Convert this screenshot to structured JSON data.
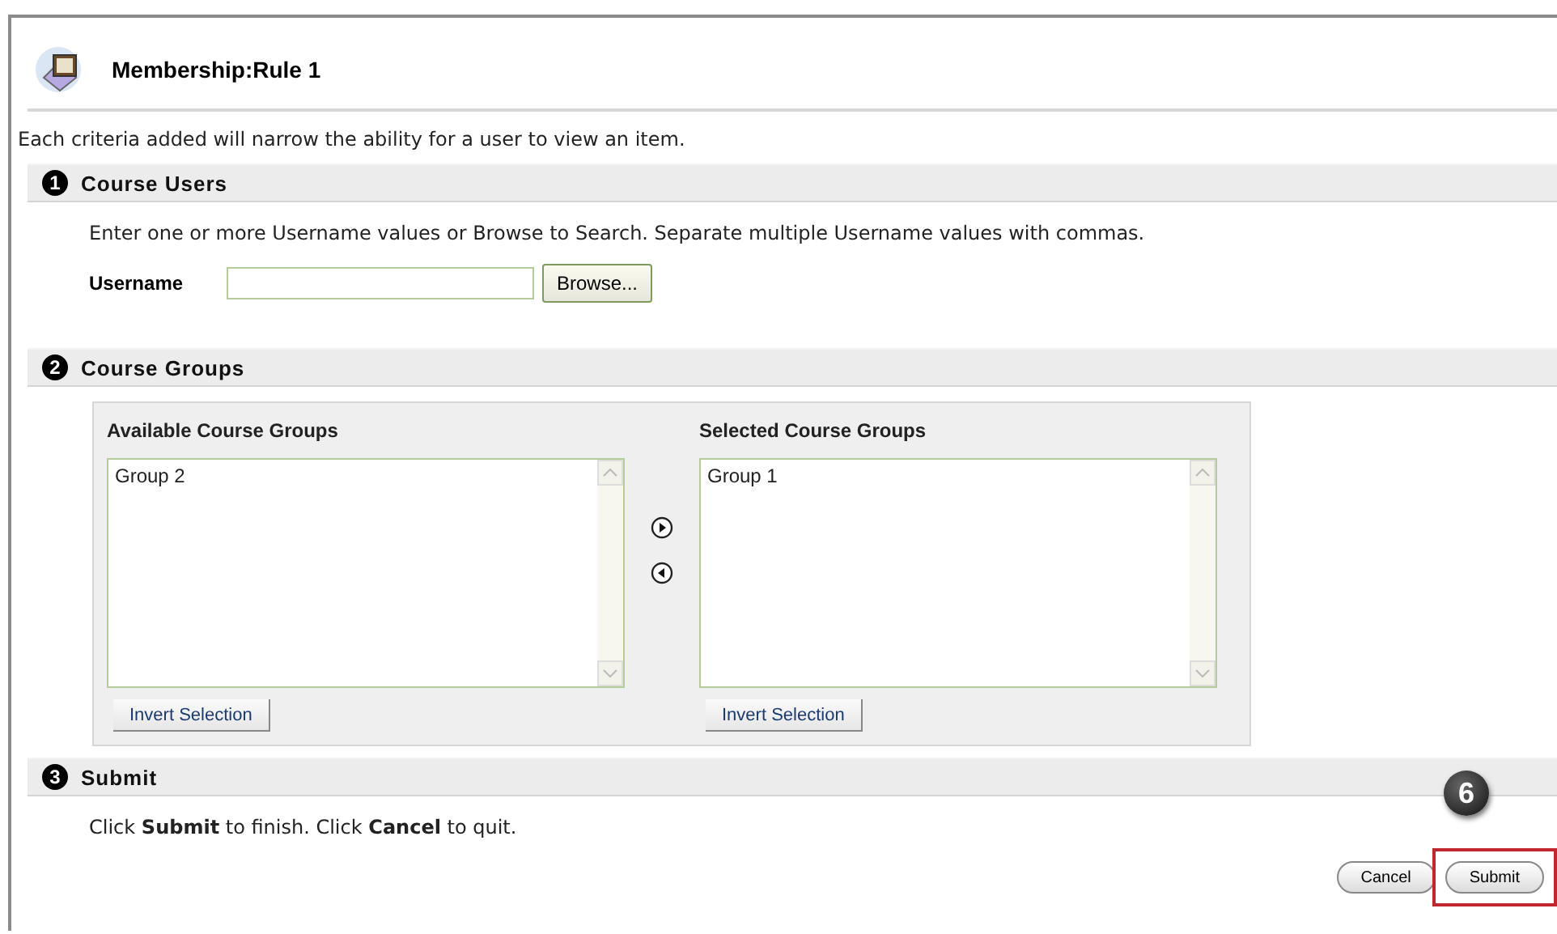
{
  "page": {
    "title": "Membership:Rule 1",
    "intro": "Each criteria added will narrow the ability for a user to view an item."
  },
  "steps": [
    {
      "number": "1",
      "title": "Course Users"
    },
    {
      "number": "2",
      "title": "Course Groups"
    },
    {
      "number": "3",
      "title": "Submit"
    }
  ],
  "course_users": {
    "instructions": "Enter one or more Username values or Browse to Search. Separate multiple Username values with commas.",
    "label": "Username",
    "browse_button": "Browse..."
  },
  "course_groups": {
    "lists": [
      {
        "heading": "Available Course Groups",
        "items": [
          "Group 2"
        ],
        "button": "Invert Selection"
      },
      {
        "heading": "Selected Course Groups",
        "items": [
          "Group 1"
        ],
        "button": "Invert Selection"
      }
    ]
  },
  "submit": {
    "instructions": "Click **Submit** to finish. Click **Cancel** to quit.",
    "buttons": [
      {
        "label": "Cancel",
        "highlighted": false
      },
      {
        "label": "Submit",
        "highlighted": true
      }
    ],
    "callout": "6"
  }
}
